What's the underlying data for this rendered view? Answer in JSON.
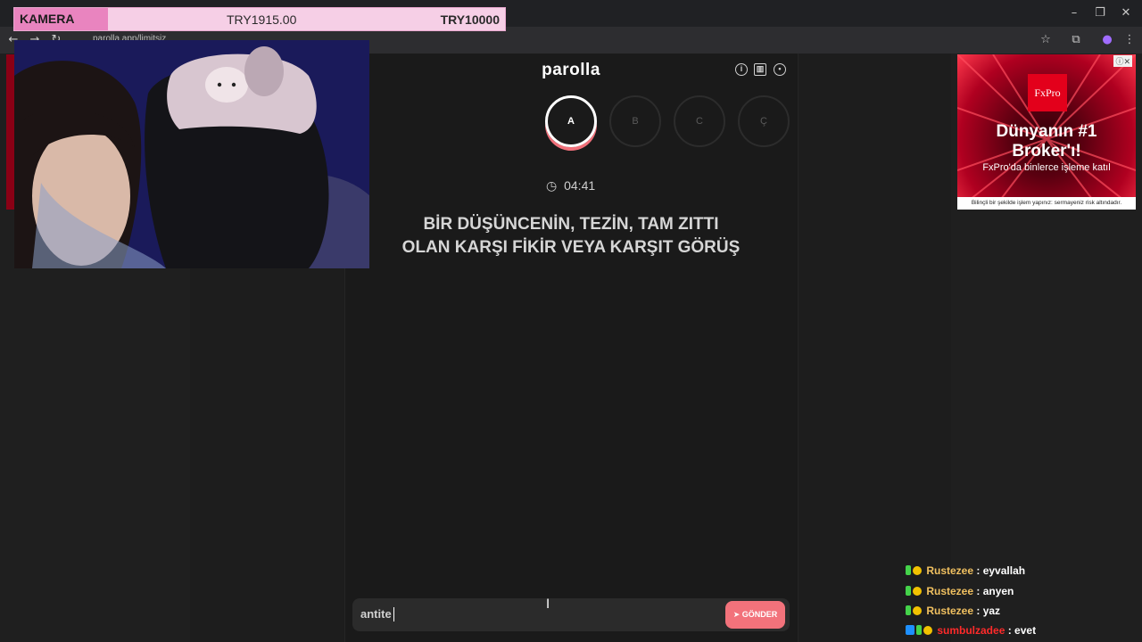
{
  "banner": {
    "label": "KAMERA",
    "current": "TRY1915.00",
    "goal": "TRY10000",
    "progress_fraction": 0.19
  },
  "browser": {
    "url": "parolla.app/limitsiz"
  },
  "game": {
    "logo": "parolla",
    "letters": [
      {
        "label": "A",
        "state": "active"
      },
      {
        "label": "B",
        "state": "pending"
      },
      {
        "label": "C",
        "state": "pending"
      },
      {
        "label": "Ç",
        "state": "pending"
      }
    ],
    "timer": "04:41",
    "clue_line1": "BİR DÜŞÜNCENİN, TEZİN, TAM ZITTI",
    "clue_line2": "OLAN KARŞI FİKİR VEYA KARŞIT GÖRÜŞ",
    "answer_value": "antite",
    "send_label": "GÖNDER"
  },
  "ad": {
    "brand": "FxPro",
    "title_line1": "Dünyanın #1",
    "title_line2": "Broker'ı!",
    "subtitle": "FxPro'da binlerce işleme katıl",
    "disclaimer": "Bilinçli bir şekilde işlem yapınız: sermayeniz risk altındadır."
  },
  "chat": [
    {
      "user": "Rustezee",
      "message": "eyvallah",
      "name_color": "#f0c060"
    },
    {
      "user": "Rustezee",
      "message": "anyen",
      "name_color": "#f0c060"
    },
    {
      "user": "Rustezee",
      "message": "yaz",
      "name_color": "#f0c060"
    },
    {
      "user": "sumbulzadee",
      "message": "evet",
      "name_color": "#ff2a2a"
    }
  ],
  "colors": {
    "accent": "#f2727b",
    "banner_fill": "#e984bf",
    "banner_bg": "#f6cfe6"
  }
}
